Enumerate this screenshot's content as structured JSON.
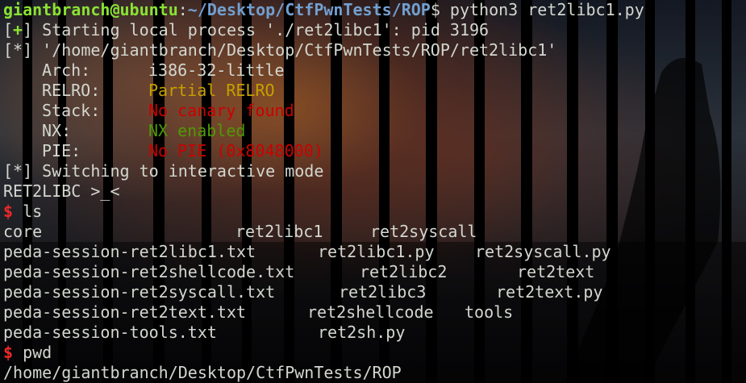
{
  "prompt": {
    "user_host": "giantbranch@ubuntu",
    "path": "~/Desktop/CtfPwnTests/ROP",
    "symbol": "$",
    "command": "python3 ret2libc1.py"
  },
  "output": {
    "process_bracket_open": "[",
    "process_mark": "+",
    "process_bracket_close": "]",
    "process_text": " Starting local process './ret2libc1': pid 3196",
    "binary_line": "[*] '/home/giantbranch/Desktop/CtfPwnTests/ROP/ret2libc1'",
    "checksec": [
      {
        "label": "Arch:",
        "value": "i386-32-little",
        "color": "#d3d7cf"
      },
      {
        "label": "RELRO:",
        "value": "Partial RELRO",
        "color": "#c4a000"
      },
      {
        "label": "Stack:",
        "value": "No canary found",
        "color": "#cc0000"
      },
      {
        "label": "NX:",
        "value": "NX enabled",
        "color": "#4e9a06"
      },
      {
        "label": "PIE:",
        "value": "No PIE (0x8048000)",
        "color": "#cc0000"
      }
    ],
    "interactive_line": "[*] Switching to interactive mode",
    "banner": "RET2LIBC >_<"
  },
  "shell": {
    "symbol": "$",
    "ls_command": "ls",
    "pwd_command": "pwd",
    "pwd_output": "/home/giantbranch/Desktop/CtfPwnTests/ROP"
  },
  "ls_rows": [
    [
      "core",
      "ret2libc1",
      "ret2syscall"
    ],
    [
      "peda-session-ret2libc1.txt",
      "ret2libc1.py",
      "ret2syscall.py"
    ],
    [
      "peda-session-ret2shellcode.txt",
      "ret2libc2",
      "ret2text"
    ],
    [
      "peda-session-ret2syscall.txt",
      "ret2libc3",
      "ret2text.py"
    ],
    [
      "peda-session-ret2text.txt",
      "ret2shellcode",
      "tools"
    ],
    [
      "peda-session-tools.txt",
      "ret2sh.py",
      ""
    ]
  ],
  "theme": {
    "prompt_user_color": "#8ae234",
    "prompt_path_color": "#729fcf",
    "shell_symbol_color": "#ef2929"
  }
}
